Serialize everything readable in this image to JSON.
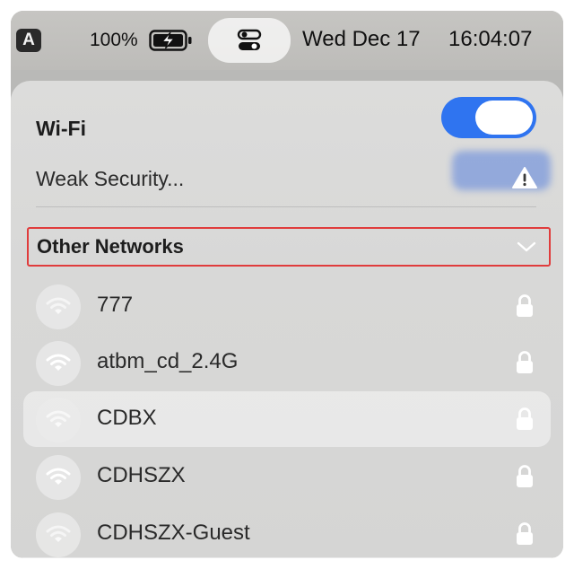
{
  "menubar": {
    "input_source": "A",
    "battery_percent": "100%",
    "date": "Wed Dec 17",
    "time": "16:04:07"
  },
  "wifi_panel": {
    "title": "Wi-Fi",
    "enabled": true,
    "current_network_label": "Weak Security...",
    "other_networks_label": "Other Networks",
    "networks": [
      {
        "name": "777",
        "secured": true,
        "signal": "weak"
      },
      {
        "name": "atbm_cd_2.4G",
        "secured": true,
        "signal": "strong"
      },
      {
        "name": "CDBX",
        "secured": true,
        "signal": "weak"
      },
      {
        "name": "CDHSZX",
        "secured": true,
        "signal": "strong"
      },
      {
        "name": "CDHSZX-Guest",
        "secured": true,
        "signal": "weak"
      }
    ]
  },
  "colors": {
    "toggle_on": "#2f74f0",
    "highlight_border": "#e03c3c"
  },
  "icons": {
    "battery": "battery-charging-icon",
    "control_center": "control-center-icon",
    "warning": "warning-triangle-icon",
    "chevron": "chevron-down-icon",
    "wifi": "wifi-icon",
    "lock": "lock-icon"
  }
}
